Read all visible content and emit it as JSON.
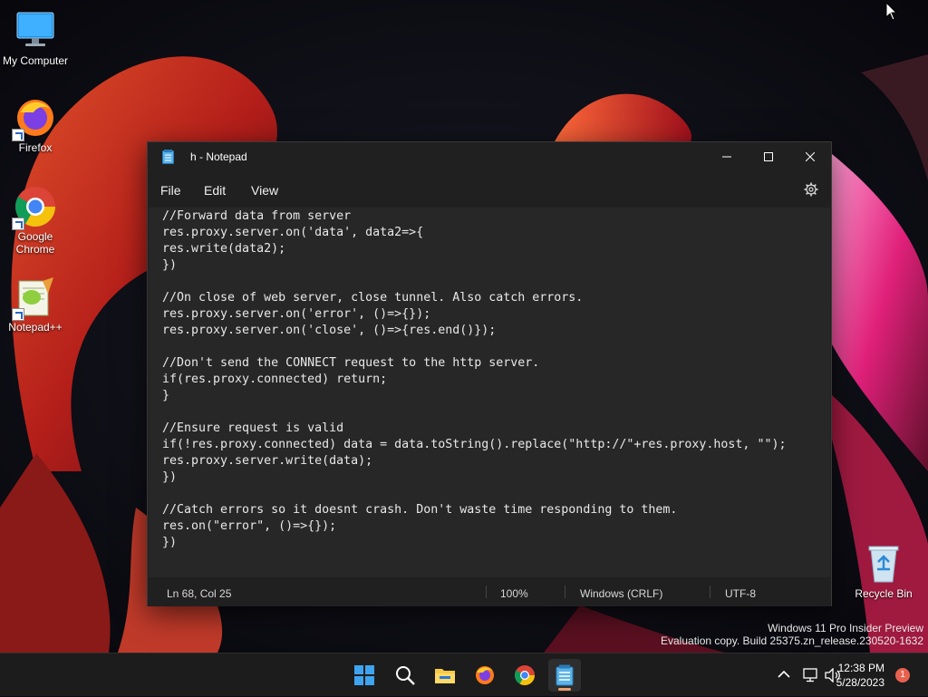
{
  "desktop": {
    "icons": [
      {
        "label": "My Computer"
      },
      {
        "label": "Firefox"
      },
      {
        "label": "Google Chrome"
      },
      {
        "label": "Notepad++"
      },
      {
        "label": "Recycle Bin"
      }
    ]
  },
  "notepad": {
    "title": "h - Notepad",
    "menu": {
      "file": "File",
      "edit": "Edit",
      "view": "View"
    },
    "code": "//Forward data from server\nres.proxy.server.on('data', data2=>{\nres.write(data2);\n})\n\n//On close of web server, close tunnel. Also catch errors.\nres.proxy.server.on('error', ()=>{});\nres.proxy.server.on('close', ()=>{res.end()});\n\n//Don't send the CONNECT request to the http server.\nif(res.proxy.connected) return;\n}\n\n//Ensure request is valid\nif(!res.proxy.connected) data = data.toString().replace(\"http://\"+res.proxy.host, \"\");\nres.proxy.server.write(data);\n})\n\n//Catch errors so it doesnt crash. Don't waste time responding to them.\nres.on(\"error\", ()=>{});\n})",
    "status": {
      "position": "Ln 68, Col 25",
      "zoom": "100%",
      "line_ending": "Windows (CRLF)",
      "encoding": "UTF-8"
    }
  },
  "watermark": {
    "line1": "Windows 11 Pro Insider Preview",
    "line2": "Evaluation copy. Build 25375.zn_release.230520-1632"
  },
  "taskbar": {
    "clock_time": "12:38 PM",
    "clock_date": "5/28/2023",
    "notification_count": "1"
  },
  "colors": {
    "accent": "#e8a16f",
    "badge": "#e8614f"
  }
}
